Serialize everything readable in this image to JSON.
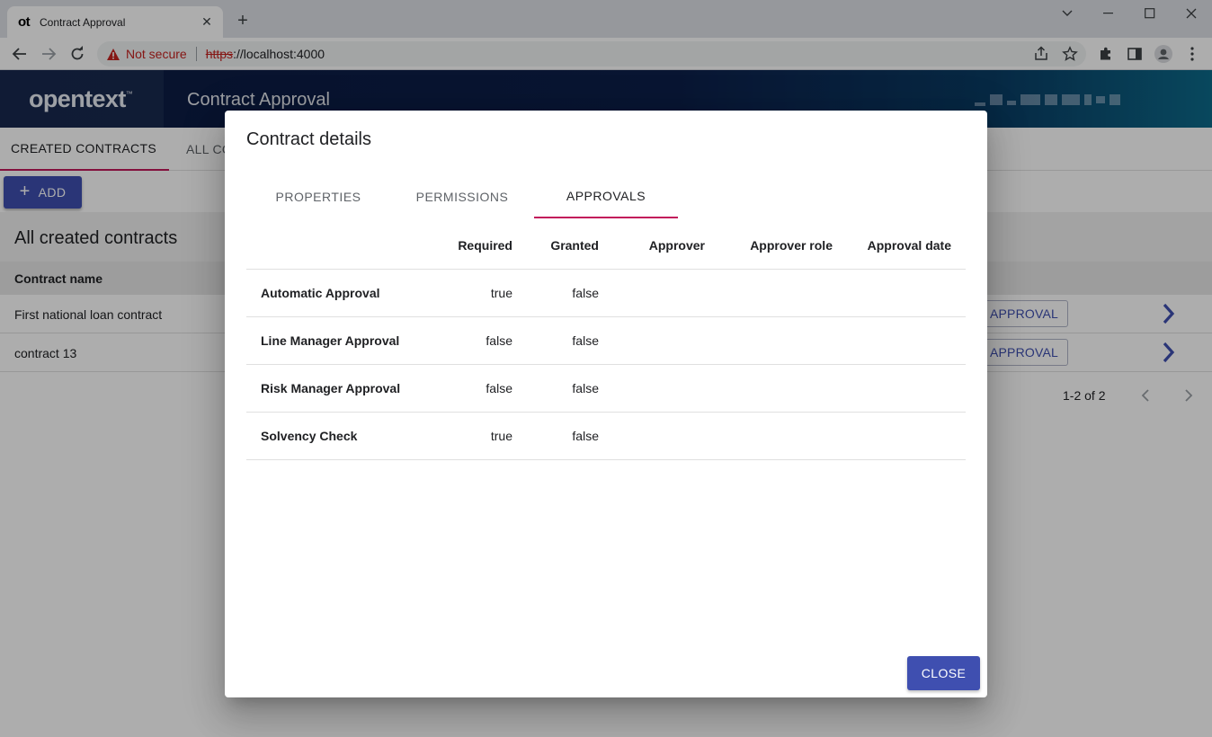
{
  "browser": {
    "tab_favicon": "ot",
    "tab_title": "Contract Approval",
    "tab_close": "✕",
    "new_tab": "+",
    "not_secure": "Not secure",
    "url_scheme": "https",
    "url_rest": "://localhost:4000"
  },
  "app": {
    "logo": "opentext",
    "logo_tm": "™",
    "title": "Contract Approval"
  },
  "nav": {
    "tabs": [
      "CREATED CONTRACTS",
      "ALL CO"
    ]
  },
  "add_button": {
    "icon": "+",
    "label": "ADD"
  },
  "list": {
    "title": "All created contracts",
    "column_header": "Contract name",
    "rows": [
      {
        "name": "First national loan contract",
        "action": "T APPROVAL"
      },
      {
        "name": "contract 13",
        "action": "T APPROVAL"
      }
    ],
    "paginator": "1-2 of 2"
  },
  "dialog": {
    "title": "Contract details",
    "tabs": [
      "PROPERTIES",
      "PERMISSIONS",
      "APPROVALS"
    ],
    "active_tab": "APPROVALS",
    "columns": [
      "",
      "Required",
      "Granted",
      "Approver",
      "Approver role",
      "Approval date"
    ],
    "rows": [
      {
        "name": "Automatic Approval",
        "required": "true",
        "granted": "false",
        "approver": "",
        "approver_role": "",
        "approval_date": ""
      },
      {
        "name": "Line Manager Approval",
        "required": "false",
        "granted": "false",
        "approver": "",
        "approver_role": "",
        "approval_date": ""
      },
      {
        "name": "Risk Manager Approval",
        "required": "false",
        "granted": "false",
        "approver": "",
        "approver_role": "",
        "approval_date": ""
      },
      {
        "name": "Solvency Check",
        "required": "true",
        "granted": "false",
        "approver": "",
        "approver_role": "",
        "approval_date": ""
      }
    ],
    "close_label": "CLOSE"
  },
  "colors": {
    "primary": "#3f4fb0",
    "tab_indicator": "#c2185b",
    "header_dark": "#0b1c43",
    "warning_red": "#c5221f"
  },
  "icons": {
    "back": "arrow-left-icon",
    "forward": "arrow-right-icon",
    "reload": "reload-icon",
    "warning": "warning-triangle-icon",
    "share": "share-icon",
    "bookmark": "star-icon",
    "extensions": "puzzle-icon",
    "side_panel": "side-panel-icon",
    "profile": "profile-icon",
    "menu": "kebab-menu-icon",
    "row_open": "chevron-right-icon"
  }
}
